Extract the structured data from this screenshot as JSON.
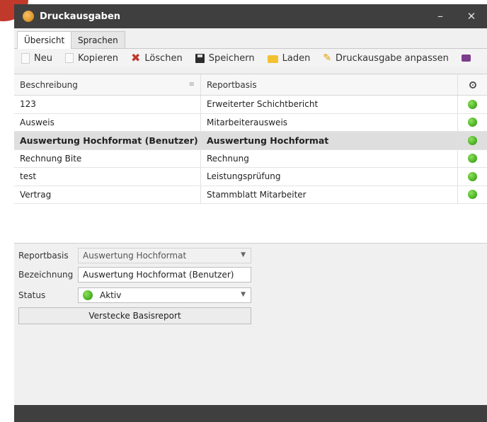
{
  "window": {
    "title": "Druckausgaben",
    "minimize": "–",
    "close": "✕"
  },
  "tabs": [
    {
      "label": "Übersicht",
      "active": true
    },
    {
      "label": "Sprachen",
      "active": false
    }
  ],
  "toolbar": {
    "new_label": "Neu",
    "copy_label": "Kopieren",
    "delete_label": "Löschen",
    "save_label": "Speichern",
    "load_label": "Laden",
    "customize_label": "Druckausgabe anpassen",
    "icons": {
      "new": "new-document-icon",
      "copy": "copy-icon",
      "delete": "delete-icon",
      "save": "save-icon",
      "load": "folder-icon",
      "customize": "pencil-icon",
      "print": "print-icon"
    }
  },
  "grid": {
    "columns": {
      "description": "Beschreibung",
      "report_basis": "Reportbasis",
      "status_icon": "status-icon"
    },
    "rows": [
      {
        "description": "123",
        "report_basis": "Erweiterter Schichtbericht",
        "status": "green"
      },
      {
        "description": "Ausweis",
        "report_basis": "Mitarbeiterausweis",
        "status": "green"
      },
      {
        "description": "Auswertung Hochformat (Benutzer)",
        "report_basis": "Auswertung Hochformat",
        "status": "green",
        "selected": true
      },
      {
        "description": "Rechnung Bite",
        "report_basis": "Rechnung",
        "status": "green"
      },
      {
        "description": "test",
        "report_basis": "Leistungsprüfung",
        "status": "green"
      },
      {
        "description": "Vertrag",
        "report_basis": "Stammblatt Mitarbeiter",
        "status": "green"
      }
    ]
  },
  "form": {
    "report_basis_label": "Reportbasis",
    "report_basis_value": "Auswertung Hochformat",
    "name_label": "Bezeichnung",
    "name_value": "Auswertung Hochformat (Benutzer)",
    "status_label": "Status",
    "status_value": "Aktiv",
    "hide_base_report_label": "Verstecke Basisreport"
  },
  "colors": {
    "titlebar": "#3f3f3f",
    "status_active": "#52b82a",
    "delete_icon": "#c0392b",
    "selected_row": "#dedede"
  }
}
